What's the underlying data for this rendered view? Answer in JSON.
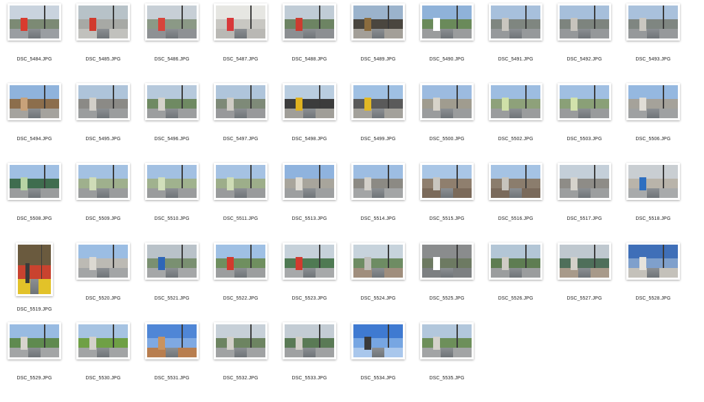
{
  "files": [
    {
      "name": "DSC_5484.JPG",
      "orientation": "landscape",
      "palette": [
        "#c9d3de",
        "#7c8a74",
        "#9a9ea2",
        "#d83b2e"
      ]
    },
    {
      "name": "DSC_5485.JPG",
      "orientation": "landscape",
      "palette": [
        "#b7c2c8",
        "#a7a9a5",
        "#c1c1bd",
        "#d13a2d"
      ]
    },
    {
      "name": "DSC_5486.JPG",
      "orientation": "landscape",
      "palette": [
        "#c7cfd6",
        "#8b9986",
        "#8e9194",
        "#d8443a"
      ]
    },
    {
      "name": "DSC_5487.JPG",
      "orientation": "landscape",
      "palette": [
        "#e6e6e2",
        "#c8c7c2",
        "#b9b8b4",
        "#d8383a"
      ]
    },
    {
      "name": "DSC_5488.JPG",
      "orientation": "landscape",
      "palette": [
        "#c0ccd6",
        "#6d8463",
        "#8c8f92",
        "#cc3c30"
      ]
    },
    {
      "name": "DSC_5489.JPG",
      "orientation": "landscape",
      "palette": [
        "#9bb3cc",
        "#4a463f",
        "#a39f98",
        "#8b6c3e"
      ]
    },
    {
      "name": "DSC_5490.JPG",
      "orientation": "landscape",
      "palette": [
        "#8fb2d9",
        "#6a8a5a",
        "#9a9c9d",
        "#ffffff"
      ]
    },
    {
      "name": "DSC_5491.JPG",
      "orientation": "landscape",
      "palette": [
        "#a7c0dc",
        "#7f8680",
        "#96999b",
        "#c9c6bf"
      ]
    },
    {
      "name": "DSC_5492.JPG",
      "orientation": "landscape",
      "palette": [
        "#a6bfdb",
        "#7d847e",
        "#95989a",
        "#c7c4bd"
      ]
    },
    {
      "name": "DSC_5493.JPG",
      "orientation": "landscape",
      "palette": [
        "#a9c1dc",
        "#7f8681",
        "#96999b",
        "#cac7c0"
      ]
    },
    {
      "name": "DSC_5494.JPG",
      "orientation": "landscape",
      "palette": [
        "#8fb3dc",
        "#8c6e4c",
        "#a5a39e",
        "#c8a27a"
      ]
    },
    {
      "name": "DSC_5495.JPG",
      "orientation": "landscape",
      "palette": [
        "#aec4da",
        "#8b8a86",
        "#9b9d9e",
        "#d2cfc8"
      ]
    },
    {
      "name": "DSC_5496.JPG",
      "orientation": "landscape",
      "palette": [
        "#b6c9dc",
        "#6f8a62",
        "#9c9e9f",
        "#d5d2cb"
      ]
    },
    {
      "name": "DSC_5497.JPG",
      "orientation": "landscape",
      "palette": [
        "#afc5db",
        "#7e8a78",
        "#98999b",
        "#cfccc5"
      ]
    },
    {
      "name": "DSC_5498.JPG",
      "orientation": "landscape",
      "palette": [
        "#b9cde0",
        "#3c3c3c",
        "#a09e98",
        "#e0b21f"
      ]
    },
    {
      "name": "DSC_5499.JPG",
      "orientation": "landscape",
      "palette": [
        "#9fc0e3",
        "#5a5a5a",
        "#a3a19b",
        "#e2b824"
      ]
    },
    {
      "name": "DSC_5500.JPG",
      "orientation": "landscape",
      "palette": [
        "#9cbbe0",
        "#a09c8f",
        "#9a9c9d",
        "#d7d3c9"
      ]
    },
    {
      "name": "DSC_5502.JPG",
      "orientation": "landscape",
      "palette": [
        "#9dbde1",
        "#8ea17a",
        "#9a9c9d",
        "#cfe0a8"
      ]
    },
    {
      "name": "DSC_5503.JPG",
      "orientation": "landscape",
      "palette": [
        "#a0bfe2",
        "#8aa077",
        "#999b9c",
        "#d2e2ab"
      ]
    },
    {
      "name": "DSC_5506.JPG",
      "orientation": "landscape",
      "palette": [
        "#95b8e0",
        "#a5a29a",
        "#9fa1a2",
        "#e0ddd6"
      ]
    },
    {
      "name": "DSC_5508.JPG",
      "orientation": "landscape",
      "palette": [
        "#9fbfe3",
        "#3f6d4f",
        "#9a9c9d",
        "#b8d3a5"
      ]
    },
    {
      "name": "DSC_5509.JPG",
      "orientation": "landscape",
      "palette": [
        "#a3c1e2",
        "#9fb08d",
        "#9a9c9d",
        "#cfdcb8"
      ]
    },
    {
      "name": "DSC_5510.JPG",
      "orientation": "landscape",
      "palette": [
        "#a2c0e2",
        "#a0b28e",
        "#9a9c9d",
        "#d1dfbb"
      ]
    },
    {
      "name": "DSC_5511.JPG",
      "orientation": "landscape",
      "palette": [
        "#a5c2e3",
        "#9dae8a",
        "#999b9c",
        "#cedcb6"
      ]
    },
    {
      "name": "DSC_5513.JPG",
      "orientation": "landscape",
      "palette": [
        "#8fb3de",
        "#a8a59c",
        "#9d9fa0",
        "#dedbd3"
      ]
    },
    {
      "name": "DSC_5514.JPG",
      "orientation": "landscape",
      "palette": [
        "#9dbde2",
        "#8c8a84",
        "#a3a5a6",
        "#d3d0c9"
      ]
    },
    {
      "name": "DSC_5515.JPG",
      "orientation": "landscape",
      "palette": [
        "#a9c6e6",
        "#8f7f6e",
        "#7b6a5a",
        "#c9c6bf"
      ]
    },
    {
      "name": "DSC_5516.JPG",
      "orientation": "landscape",
      "palette": [
        "#a5c3e4",
        "#8b7d6d",
        "#7a6a5b",
        "#c7c4bd"
      ]
    },
    {
      "name": "DSC_5517.JPG",
      "orientation": "landscape",
      "palette": [
        "#c4cfd9",
        "#8e8c87",
        "#9c9e9f",
        "#d6d3cc"
      ]
    },
    {
      "name": "DSC_5518.JPG",
      "orientation": "landscape",
      "palette": [
        "#c9ced2",
        "#b9b4aa",
        "#a8aaab",
        "#2e6fc0"
      ]
    },
    {
      "name": "DSC_5519.JPG",
      "orientation": "portrait",
      "palette": [
        "#6a5a3e",
        "#c9432f",
        "#e2c229",
        "#3a3a3a"
      ]
    },
    {
      "name": "DSC_5520.JPG",
      "orientation": "landscape",
      "palette": [
        "#9bbde3",
        "#bcbab4",
        "#a3a5a6",
        "#dcd9d2"
      ]
    },
    {
      "name": "DSC_5521.JPG",
      "orientation": "landscape",
      "palette": [
        "#b9c2c9",
        "#7a9071",
        "#a5a7a8",
        "#2f66b7"
      ]
    },
    {
      "name": "DSC_5522.JPG",
      "orientation": "landscape",
      "palette": [
        "#9fc0e4",
        "#6f8f5f",
        "#9c9e9f",
        "#d23a2e"
      ]
    },
    {
      "name": "DSC_5523.JPG",
      "orientation": "landscape",
      "palette": [
        "#c6d1da",
        "#4f7a53",
        "#a7a9aa",
        "#d13a2f"
      ]
    },
    {
      "name": "DSC_5524.JPG",
      "orientation": "landscape",
      "palette": [
        "#c7d3dc",
        "#6e8c63",
        "#a08e7d",
        "#bfbdb8"
      ]
    },
    {
      "name": "DSC_5525.JPG",
      "orientation": "landscape",
      "palette": [
        "#8a8c8d",
        "#6d7a62",
        "#7d8082",
        "#ffffff"
      ]
    },
    {
      "name": "DSC_5526.JPG",
      "orientation": "landscape",
      "palette": [
        "#b3c6d6",
        "#5e7d52",
        "#9b9d9e",
        "#cfccc5"
      ]
    },
    {
      "name": "DSC_5527.JPG",
      "orientation": "landscape",
      "palette": [
        "#bfc8cf",
        "#4f6f5a",
        "#a89a8a",
        "#d4d1ca"
      ]
    },
    {
      "name": "DSC_5528.JPG",
      "orientation": "landscape",
      "palette": [
        "#3f6fb8",
        "#7fa0cc",
        "#c4c1ba",
        "#e6e3dc"
      ]
    },
    {
      "name": "DSC_5529.JPG",
      "orientation": "landscape",
      "palette": [
        "#98bbe2",
        "#5f8a4f",
        "#a3a5a6",
        "#d7d4cd"
      ]
    },
    {
      "name": "DSC_5530.JPG",
      "orientation": "landscape",
      "palette": [
        "#a6c3e2",
        "#6fa045",
        "#a2a4a5",
        "#d4d1ca"
      ]
    },
    {
      "name": "DSC_5531.JPG",
      "orientation": "landscape",
      "palette": [
        "#4f86d6",
        "#7fa9e2",
        "#b87e4f",
        "#c9935f"
      ]
    },
    {
      "name": "DSC_5532.JPG",
      "orientation": "landscape",
      "palette": [
        "#c7d0d8",
        "#6d8461",
        "#a0a2a3",
        "#d3d0c9"
      ]
    },
    {
      "name": "DSC_5533.JPG",
      "orientation": "landscape",
      "palette": [
        "#c3ccd4",
        "#5a7a55",
        "#9fa1a2",
        "#d1cec7"
      ]
    },
    {
      "name": "DSC_5534.JPG",
      "orientation": "landscape",
      "palette": [
        "#3f7ad1",
        "#77a6e2",
        "#a9c7ec",
        "#3a3a3a"
      ]
    },
    {
      "name": "DSC_5535.JPG",
      "orientation": "landscape",
      "palette": [
        "#b2c7dc",
        "#6d8f5a",
        "#a2a4a5",
        "#d5d2cb"
      ]
    }
  ]
}
